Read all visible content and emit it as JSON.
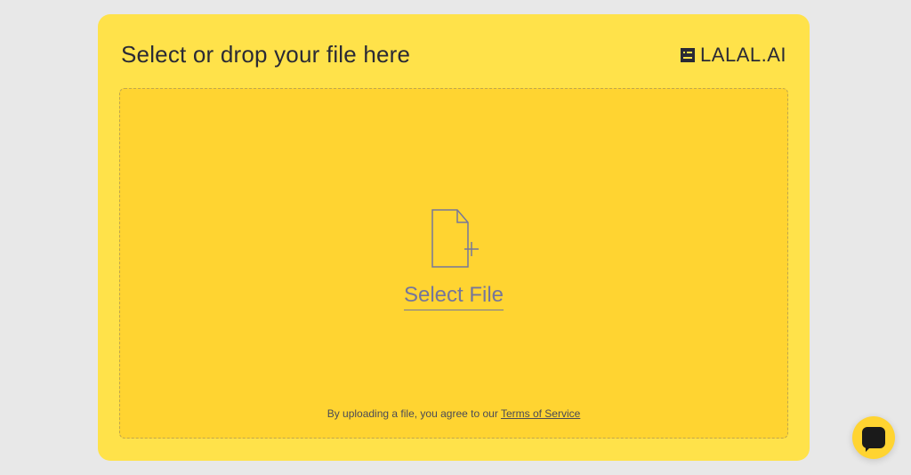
{
  "header": {
    "title": "Select or drop your file here",
    "brand": "LALAL.AI"
  },
  "dropzone": {
    "select_label": "Select File",
    "disclaimer_prefix": "By uploading a file, you agree to our ",
    "terms_label": "Terms of Service"
  }
}
